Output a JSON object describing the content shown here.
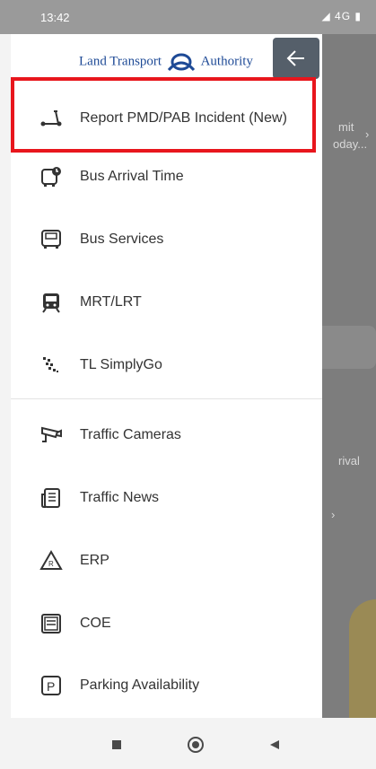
{
  "status_bar": {
    "time": "13:42",
    "network": "4G"
  },
  "header": {
    "logo_left": "Land Transport",
    "logo_right": "Authority"
  },
  "menu": {
    "items": [
      {
        "label": "Report PMD/PAB Incident (New)",
        "icon": "scooter-icon"
      },
      {
        "label": "Bus Arrival Time",
        "icon": "bus-clock-icon"
      },
      {
        "label": "Bus Services",
        "icon": "bus-front-icon"
      },
      {
        "label": "MRT/LRT",
        "icon": "train-icon"
      },
      {
        "label": "TL SimplyGo",
        "icon": "simplygo-icon"
      },
      {
        "label": "Traffic Cameras",
        "icon": "camera-icon"
      },
      {
        "label": "Traffic News",
        "icon": "news-icon"
      },
      {
        "label": "ERP",
        "icon": "erp-icon"
      },
      {
        "label": "COE",
        "icon": "coe-icon"
      },
      {
        "label": "Parking Availability",
        "icon": "parking-icon"
      }
    ]
  },
  "background": {
    "text1": "mit",
    "text2": "oday...",
    "text3": "rival"
  },
  "colors": {
    "highlight": "#e8161d",
    "back_button": "#555f6a",
    "logo_blue": "#1e4a96"
  }
}
